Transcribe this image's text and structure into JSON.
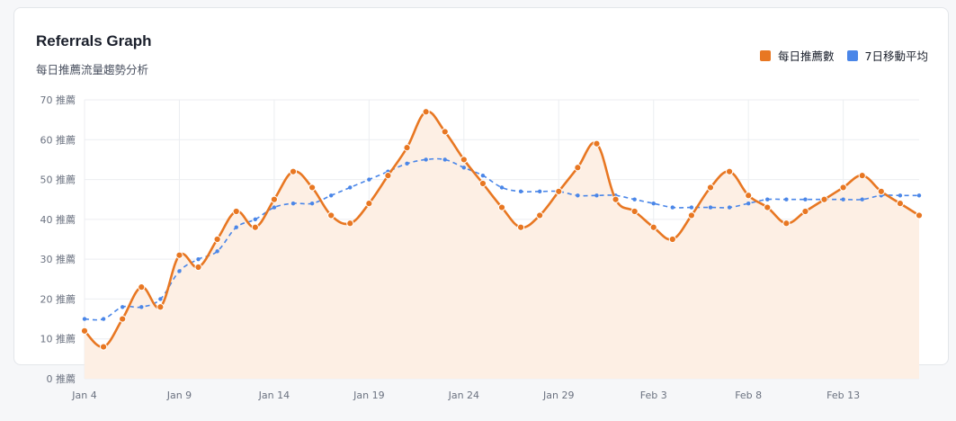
{
  "header": {
    "title": "Referrals Graph",
    "subtitle": "每日推薦流量趨勢分析"
  },
  "colors": {
    "daily": "#e87722",
    "daily_fill": "#fdefe4",
    "average": "#4a86e8",
    "grid": "#eceef1"
  },
  "chart_data": {
    "type": "line",
    "title": "Referrals Graph",
    "subtitle": "每日推薦流量趨勢分析",
    "xlabel": "",
    "ylabel": "",
    "ylim": [
      0,
      70
    ],
    "y_unit": "推薦",
    "y_ticks": [
      "0 推薦",
      "10 推薦",
      "20 推薦",
      "30 推薦",
      "40 推薦",
      "50 推薦",
      "60 推薦",
      "70 推薦"
    ],
    "x_tick_labels": [
      "Jan 4",
      "Jan 9",
      "Jan 14",
      "Jan 19",
      "Jan 24",
      "Jan 29",
      "Feb 3",
      "Feb 8",
      "Feb 13"
    ],
    "x": [
      "Jan 4",
      "Jan 5",
      "Jan 6",
      "Jan 7",
      "Jan 8",
      "Jan 9",
      "Jan 10",
      "Jan 11",
      "Jan 12",
      "Jan 13",
      "Jan 14",
      "Jan 15",
      "Jan 16",
      "Jan 17",
      "Jan 18",
      "Jan 19",
      "Jan 20",
      "Jan 21",
      "Jan 22",
      "Jan 23",
      "Jan 24",
      "Jan 25",
      "Jan 26",
      "Jan 27",
      "Jan 28",
      "Jan 29",
      "Jan 30",
      "Jan 31",
      "Feb 1",
      "Feb 2",
      "Feb 3",
      "Feb 4",
      "Feb 5",
      "Feb 6",
      "Feb 7",
      "Feb 8",
      "Feb 9",
      "Feb 10",
      "Feb 11",
      "Feb 12",
      "Feb 13",
      "Feb 14",
      "Feb 15",
      "Feb 16",
      "Feb 17"
    ],
    "grid": true,
    "legend_position": "top-right",
    "series": [
      {
        "name": "每日推薦數",
        "style": "solid-area",
        "values": [
          12,
          8,
          15,
          23,
          18,
          31,
          28,
          35,
          42,
          38,
          45,
          52,
          48,
          41,
          39,
          44,
          51,
          58,
          67,
          62,
          55,
          49,
          43,
          38,
          41,
          47,
          53,
          59,
          45,
          42,
          38,
          35,
          41,
          48,
          52,
          46,
          43,
          39,
          42,
          45,
          48,
          51,
          47,
          44,
          41
        ]
      },
      {
        "name": "7日移動平均",
        "style": "dashed",
        "values": [
          15,
          15,
          18,
          18,
          20,
          27,
          30,
          32,
          38,
          40,
          43,
          44,
          44,
          46,
          48,
          50,
          52,
          54,
          55,
          55,
          53,
          51,
          48,
          47,
          47,
          47,
          46,
          46,
          46,
          45,
          44,
          43,
          43,
          43,
          43,
          44,
          45,
          45,
          45,
          45,
          45,
          45,
          46,
          46,
          46
        ]
      }
    ]
  }
}
